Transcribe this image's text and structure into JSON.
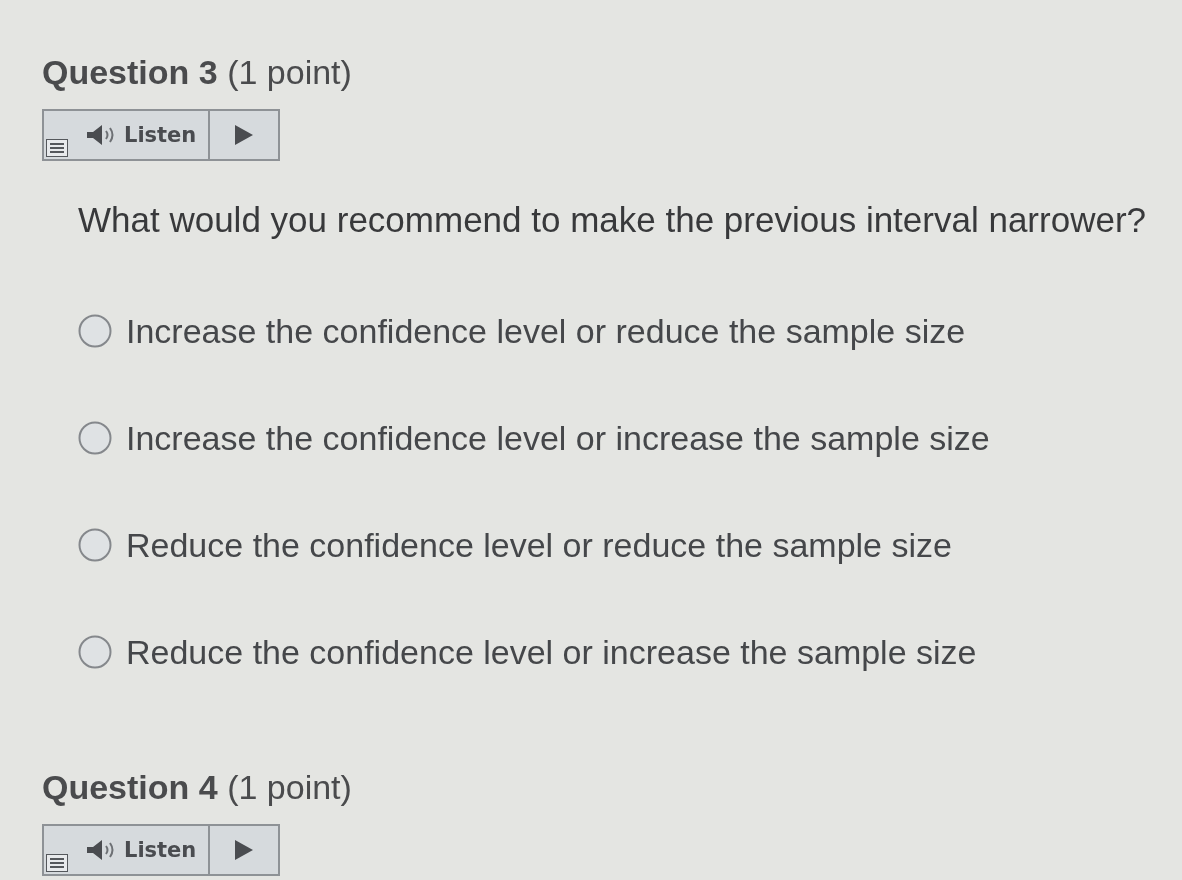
{
  "questions": [
    {
      "heading": "**Question 3** (1 point)",
      "listen": {
        "label": "Listen"
      },
      "prompt": "What would you recommend to make the previous interval narrower?",
      "options": [
        {
          "label": "Increase the confidence level or reduce the sample size",
          "selected": false
        },
        {
          "label": "Increase the confidence level or increase the sample size",
          "selected": false
        },
        {
          "label": "Reduce the confidence level or reduce the sample size",
          "selected": false
        },
        {
          "label": "Reduce the confidence level or increase the sample size",
          "selected": false
        }
      ]
    },
    {
      "heading": "**Question 4** (1 point)",
      "listen": {
        "label": "Listen"
      }
    }
  ]
}
